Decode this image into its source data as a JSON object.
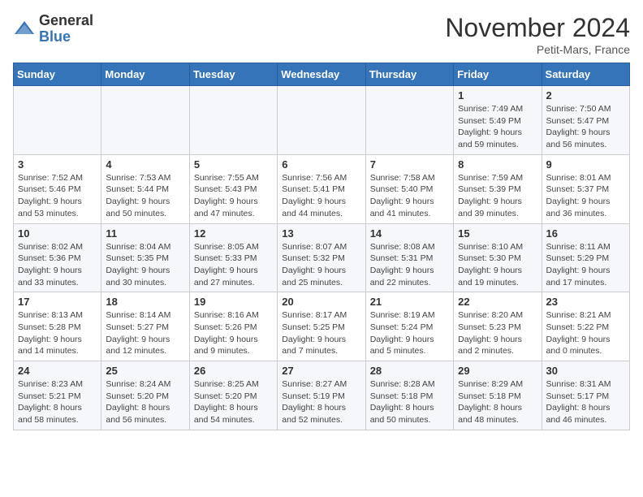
{
  "logo": {
    "general": "General",
    "blue": "Blue"
  },
  "header": {
    "month": "November 2024",
    "location": "Petit-Mars, France"
  },
  "weekdays": [
    "Sunday",
    "Monday",
    "Tuesday",
    "Wednesday",
    "Thursday",
    "Friday",
    "Saturday"
  ],
  "weeks": [
    [
      {
        "day": "",
        "sunrise": "",
        "sunset": "",
        "daylight": ""
      },
      {
        "day": "",
        "sunrise": "",
        "sunset": "",
        "daylight": ""
      },
      {
        "day": "",
        "sunrise": "",
        "sunset": "",
        "daylight": ""
      },
      {
        "day": "",
        "sunrise": "",
        "sunset": "",
        "daylight": ""
      },
      {
        "day": "",
        "sunrise": "",
        "sunset": "",
        "daylight": ""
      },
      {
        "day": "1",
        "sunrise": "Sunrise: 7:49 AM",
        "sunset": "Sunset: 5:49 PM",
        "daylight": "Daylight: 9 hours and 59 minutes."
      },
      {
        "day": "2",
        "sunrise": "Sunrise: 7:50 AM",
        "sunset": "Sunset: 5:47 PM",
        "daylight": "Daylight: 9 hours and 56 minutes."
      }
    ],
    [
      {
        "day": "3",
        "sunrise": "Sunrise: 7:52 AM",
        "sunset": "Sunset: 5:46 PM",
        "daylight": "Daylight: 9 hours and 53 minutes."
      },
      {
        "day": "4",
        "sunrise": "Sunrise: 7:53 AM",
        "sunset": "Sunset: 5:44 PM",
        "daylight": "Daylight: 9 hours and 50 minutes."
      },
      {
        "day": "5",
        "sunrise": "Sunrise: 7:55 AM",
        "sunset": "Sunset: 5:43 PM",
        "daylight": "Daylight: 9 hours and 47 minutes."
      },
      {
        "day": "6",
        "sunrise": "Sunrise: 7:56 AM",
        "sunset": "Sunset: 5:41 PM",
        "daylight": "Daylight: 9 hours and 44 minutes."
      },
      {
        "day": "7",
        "sunrise": "Sunrise: 7:58 AM",
        "sunset": "Sunset: 5:40 PM",
        "daylight": "Daylight: 9 hours and 41 minutes."
      },
      {
        "day": "8",
        "sunrise": "Sunrise: 7:59 AM",
        "sunset": "Sunset: 5:39 PM",
        "daylight": "Daylight: 9 hours and 39 minutes."
      },
      {
        "day": "9",
        "sunrise": "Sunrise: 8:01 AM",
        "sunset": "Sunset: 5:37 PM",
        "daylight": "Daylight: 9 hours and 36 minutes."
      }
    ],
    [
      {
        "day": "10",
        "sunrise": "Sunrise: 8:02 AM",
        "sunset": "Sunset: 5:36 PM",
        "daylight": "Daylight: 9 hours and 33 minutes."
      },
      {
        "day": "11",
        "sunrise": "Sunrise: 8:04 AM",
        "sunset": "Sunset: 5:35 PM",
        "daylight": "Daylight: 9 hours and 30 minutes."
      },
      {
        "day": "12",
        "sunrise": "Sunrise: 8:05 AM",
        "sunset": "Sunset: 5:33 PM",
        "daylight": "Daylight: 9 hours and 27 minutes."
      },
      {
        "day": "13",
        "sunrise": "Sunrise: 8:07 AM",
        "sunset": "Sunset: 5:32 PM",
        "daylight": "Daylight: 9 hours and 25 minutes."
      },
      {
        "day": "14",
        "sunrise": "Sunrise: 8:08 AM",
        "sunset": "Sunset: 5:31 PM",
        "daylight": "Daylight: 9 hours and 22 minutes."
      },
      {
        "day": "15",
        "sunrise": "Sunrise: 8:10 AM",
        "sunset": "Sunset: 5:30 PM",
        "daylight": "Daylight: 9 hours and 19 minutes."
      },
      {
        "day": "16",
        "sunrise": "Sunrise: 8:11 AM",
        "sunset": "Sunset: 5:29 PM",
        "daylight": "Daylight: 9 hours and 17 minutes."
      }
    ],
    [
      {
        "day": "17",
        "sunrise": "Sunrise: 8:13 AM",
        "sunset": "Sunset: 5:28 PM",
        "daylight": "Daylight: 9 hours and 14 minutes."
      },
      {
        "day": "18",
        "sunrise": "Sunrise: 8:14 AM",
        "sunset": "Sunset: 5:27 PM",
        "daylight": "Daylight: 9 hours and 12 minutes."
      },
      {
        "day": "19",
        "sunrise": "Sunrise: 8:16 AM",
        "sunset": "Sunset: 5:26 PM",
        "daylight": "Daylight: 9 hours and 9 minutes."
      },
      {
        "day": "20",
        "sunrise": "Sunrise: 8:17 AM",
        "sunset": "Sunset: 5:25 PM",
        "daylight": "Daylight: 9 hours and 7 minutes."
      },
      {
        "day": "21",
        "sunrise": "Sunrise: 8:19 AM",
        "sunset": "Sunset: 5:24 PM",
        "daylight": "Daylight: 9 hours and 5 minutes."
      },
      {
        "day": "22",
        "sunrise": "Sunrise: 8:20 AM",
        "sunset": "Sunset: 5:23 PM",
        "daylight": "Daylight: 9 hours and 2 minutes."
      },
      {
        "day": "23",
        "sunrise": "Sunrise: 8:21 AM",
        "sunset": "Sunset: 5:22 PM",
        "daylight": "Daylight: 9 hours and 0 minutes."
      }
    ],
    [
      {
        "day": "24",
        "sunrise": "Sunrise: 8:23 AM",
        "sunset": "Sunset: 5:21 PM",
        "daylight": "Daylight: 8 hours and 58 minutes."
      },
      {
        "day": "25",
        "sunrise": "Sunrise: 8:24 AM",
        "sunset": "Sunset: 5:20 PM",
        "daylight": "Daylight: 8 hours and 56 minutes."
      },
      {
        "day": "26",
        "sunrise": "Sunrise: 8:25 AM",
        "sunset": "Sunset: 5:20 PM",
        "daylight": "Daylight: 8 hours and 54 minutes."
      },
      {
        "day": "27",
        "sunrise": "Sunrise: 8:27 AM",
        "sunset": "Sunset: 5:19 PM",
        "daylight": "Daylight: 8 hours and 52 minutes."
      },
      {
        "day": "28",
        "sunrise": "Sunrise: 8:28 AM",
        "sunset": "Sunset: 5:18 PM",
        "daylight": "Daylight: 8 hours and 50 minutes."
      },
      {
        "day": "29",
        "sunrise": "Sunrise: 8:29 AM",
        "sunset": "Sunset: 5:18 PM",
        "daylight": "Daylight: 8 hours and 48 minutes."
      },
      {
        "day": "30",
        "sunrise": "Sunrise: 8:31 AM",
        "sunset": "Sunset: 5:17 PM",
        "daylight": "Daylight: 8 hours and 46 minutes."
      }
    ]
  ]
}
